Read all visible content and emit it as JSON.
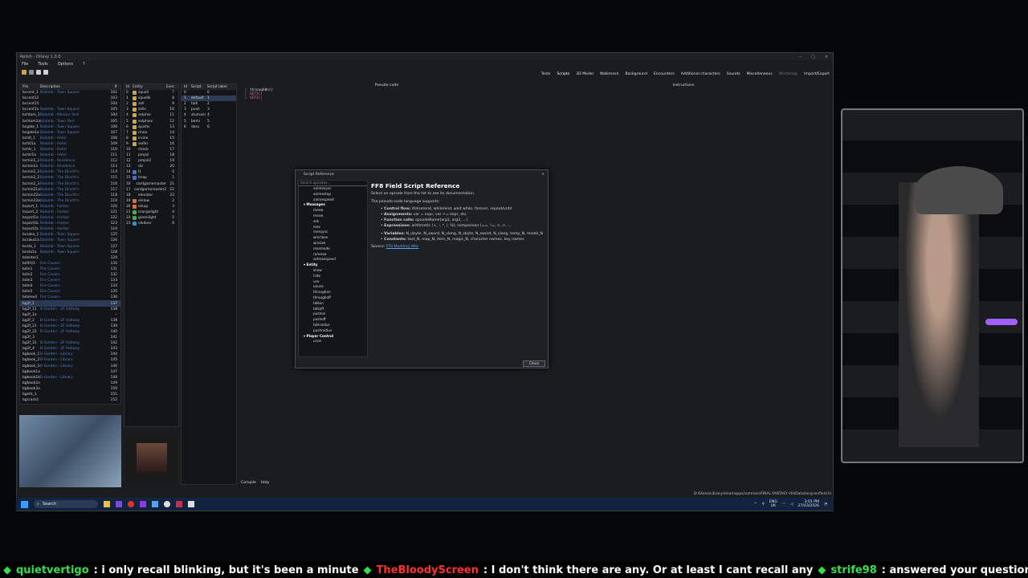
{
  "window": {
    "title": "Relish - Orlevy 1.0.0",
    "menu": [
      "File",
      "Tools",
      "Options",
      "?"
    ],
    "tabs": [
      "Texts",
      "Scripts",
      "3D Model",
      "Walkmesh",
      "Background",
      "Encounters",
      "Additional characters",
      "Sounds",
      "Miscellaneous",
      "Worldmap",
      "Import/Export"
    ],
    "active_tab": "Scripts"
  },
  "file_table": {
    "headers": [
      "File",
      "Description",
      "#"
    ],
    "rows": [
      [
        "bccent_1",
        "Balamb - Town Square",
        "102"
      ],
      [
        "bccent12",
        "",
        "103"
      ],
      [
        "bccent15",
        "",
        "104"
      ],
      [
        "bccent1a",
        "Balamb - Town Square",
        "105"
      ],
      [
        "bchtom_1",
        "Balamb - Mission Yard",
        "104"
      ],
      [
        "bchtom1a",
        "Balamb - Town Yard",
        "105"
      ],
      [
        "bcgate_1",
        "Balamb - Town Square",
        "106"
      ],
      [
        "bcgate1a",
        "Balamb - Town Square",
        "107"
      ],
      [
        "bchtl_1",
        "Balamb - Hotel",
        "108"
      ],
      [
        "bchtl1a",
        "Balamb - Hotel",
        "109"
      ],
      [
        "bchtr_1",
        "Balamb - Hotel",
        "110"
      ],
      [
        "bchtr1a",
        "Balamb - Hotel",
        "111"
      ],
      [
        "bcmin1_1",
        "Balamb - Residence",
        "112"
      ],
      [
        "bcmin1a",
        "Balamb - Residence",
        "113"
      ],
      [
        "bcmin2_1",
        "Balamb - The Dincht's",
        "114"
      ],
      [
        "bcmin2_2",
        "Balamb - The Dincht's",
        "115"
      ],
      [
        "bcmin2_3",
        "Balamb - The Dincht's",
        "116"
      ],
      [
        "bcmin21a",
        "Balamb - The Dincht's",
        "117"
      ],
      [
        "bcmin22a",
        "Balamb - The Dincht's",
        "118"
      ],
      [
        "bcmin23a",
        "Balamb - The Dincht's",
        "119"
      ],
      [
        "bcport_1",
        "Balamb - Harbor",
        "120"
      ],
      [
        "bcport_2",
        "Balamb - Harbor",
        "121"
      ],
      [
        "bcport1a",
        "Balamb - Harbor",
        "122"
      ],
      [
        "bcport1b",
        "Balamb - Harbor",
        "123"
      ],
      [
        "bcport2a",
        "Balamb - Harbor",
        "124"
      ],
      [
        "bcsaka_1",
        "Balamb - Town Square",
        "125"
      ],
      [
        "bcsaka1a",
        "Balamb - Town Square",
        "126"
      ],
      [
        "bcsta_1",
        "Balamb - Town Square",
        "127"
      ],
      [
        "bcsta1a",
        "Balamb - Town Square",
        "128"
      ],
      [
        "bdenter1",
        "",
        "129"
      ],
      [
        "bdifrit1",
        "Fire Cavern",
        "130"
      ],
      [
        "bdin1",
        "Fire Cavern",
        "131"
      ],
      [
        "bdin2",
        "Fire Cavern",
        "132"
      ],
      [
        "bdin3",
        "Fire Cavern",
        "133"
      ],
      [
        "bdin4",
        "Fire Cavern",
        "134"
      ],
      [
        "bdin5",
        "Fire Cavern",
        "135"
      ],
      [
        "bdview1",
        "Fire Cavern",
        "136"
      ],
      [
        "bg2f_1",
        "",
        "137"
      ],
      [
        "bg2f_11",
        "B-Garden - 2F Hallway",
        "138"
      ],
      [
        "bg2f_1a",
        "",
        "--"
      ],
      [
        "bg2f_2",
        "B-Garden - 2F Hallway",
        "138"
      ],
      [
        "bg2f_21",
        "B-Garden - 2F Hallway",
        "139"
      ],
      [
        "bg2f_22",
        "B-Garden - 2F Hallway",
        "140"
      ],
      [
        "bg2f_3",
        "",
        "141"
      ],
      [
        "bg2f_31",
        "B-Garden - 2F Hallway",
        "142"
      ],
      [
        "bg2f_4",
        "B-Garden - 2F Hallway",
        "143"
      ],
      [
        "bgbook_1",
        "B-Garden - Library",
        "144"
      ],
      [
        "bgbook_2",
        "B-Garden - Library",
        "145"
      ],
      [
        "bgbook_3",
        "B-Garden - Library",
        "146"
      ],
      [
        "bgbook1a",
        "",
        "147"
      ],
      [
        "bgbook1b",
        "B-Garden - Library",
        "148"
      ],
      [
        "bgbook2a",
        "",
        "149"
      ],
      [
        "bgbook3a",
        "",
        "150"
      ],
      [
        "bgeht_1",
        "",
        "151"
      ],
      [
        "bgcrash1",
        "",
        "152"
      ]
    ]
  },
  "entity_table": {
    "headers": [
      "Id",
      "Entity",
      "Exec"
    ],
    "rows": [
      [
        "0",
        "squall",
        "7",
        "#c9a64a"
      ],
      [
        "1",
        "squallk",
        "8",
        "#c9a64a"
      ],
      [
        "2",
        "zell",
        "9",
        "#c9a64a"
      ],
      [
        "3",
        "zells",
        "10",
        "#c9a64a"
      ],
      [
        "4",
        "selphie",
        "11",
        "#c9a64a"
      ],
      [
        "5",
        "selphies",
        "12",
        "#c9a64a"
      ],
      [
        "6",
        "quistis",
        "13",
        "#c9a64a"
      ],
      [
        "7",
        "rinoa",
        "14",
        "#c9a64a"
      ],
      [
        "8",
        "irvine",
        "15",
        "#c9a64a"
      ],
      [
        "9",
        "seifer",
        "16",
        "#c9a64a"
      ],
      [
        "10",
        "check",
        "17",
        ""
      ],
      [
        "11",
        "pmpsl",
        "18",
        ""
      ],
      [
        "12",
        "pmpsl2",
        "19",
        ""
      ],
      [
        "13",
        "dic",
        "20",
        ""
      ],
      [
        "14",
        "l1",
        "0",
        "#4a6fd0"
      ],
      [
        "15",
        "lmap",
        "1",
        "#4a6fd0"
      ],
      [
        "16",
        "cardgamemaster",
        "21",
        ""
      ],
      [
        "17",
        "cardgamemaster2",
        "22",
        ""
      ],
      [
        "18",
        "elevator",
        "23",
        ""
      ],
      [
        "19",
        "elelow",
        "2",
        "#e07030"
      ],
      [
        "20",
        "eleup",
        "3",
        "#e07030"
      ],
      [
        "21",
        "orangelight",
        "4",
        "#40b040"
      ],
      [
        "22",
        "greenlight",
        "5",
        "#40b040"
      ],
      [
        "23",
        "eledoor",
        "6",
        "#3090e0"
      ]
    ]
  },
  "script_table": {
    "headers": [
      "Id",
      "Script",
      "Script label"
    ],
    "rows": [
      [
        "0",
        "",
        "0"
      ],
      [
        "1",
        "default",
        "1"
      ],
      [
        "2",
        "talk",
        "2"
      ],
      [
        "3",
        "push",
        "3"
      ],
      [
        "4",
        "stumani",
        "4"
      ],
      [
        "5",
        "bemi",
        "5"
      ],
      [
        "6",
        "deru",
        "6"
      ]
    ]
  },
  "pseudo_code": {
    "header": "Pseudo-code",
    "lines": [
      "through0n()",
      "SET3()",
      "SET3()"
    ]
  },
  "instructions_header": "Instructions",
  "bottom_bar": [
    "Compile",
    "Help"
  ],
  "status_path": "D:/SteamLibrary/steamapps/common/FINAL FANTASY VIII/Data/lang-en/field.fs",
  "dialog": {
    "title": "Script Reference",
    "search_placeholder": "Search opcodes...",
    "ops_top": [
      "animesync",
      "animestop",
      "animespeed"
    ],
    "categories": [
      {
        "name": "Messages",
        "ops": [
          "mesw",
          "mesw",
          "ask",
          "mes",
          "messync",
          "winclose",
          "winsize",
          "mesmode",
          "ramesw",
          "setmesspeed"
        ]
      },
      {
        "name": "Entity",
        "ops": [
          "show",
          "hide",
          "use",
          "unuse",
          "throughon",
          "throughoff",
          "talkon",
          "talkoff",
          "pushon",
          "pushoff",
          "talkradius",
          "pushradius"
        ]
      },
      {
        "name": "Player Control",
        "ops": [
          "ucon"
        ]
      }
    ],
    "heading": "FF8 Field Script Reference",
    "intro": "Select an opcode from the list to see its documentation.",
    "supports": "The pseudo-code language supports:",
    "features": [
      {
        "label": "Control flow:",
        "text": " if/else/end, while/end, wait while, forever, repeat/until"
      },
      {
        "label": "Assignments:",
        "text": " var = expr, var += expr, etc."
      },
      {
        "label": "Function calls:",
        "text": " opcodeName(arg1, arg2, ...)"
      },
      {
        "label": "Expressions:",
        "text": " arithmetic (+, -, *, /, %), comparison (==, !=, <, >, ..."
      }
    ],
    "features2": [
      {
        "label": "Variables:",
        "text": " N_ubyte, N_sword, N_slong, N_sbyte, N_sword, N_slong, temp_N, model_N"
      },
      {
        "label": "Constants:",
        "text": " text_N, map_N, item_N, magic_N, character names, key names"
      }
    ],
    "source_label": "Source:",
    "source_link": "FF8 Modding Wiki",
    "close_label": "Close"
  },
  "taskbar": {
    "search": "Search",
    "lang": "ENG",
    "region": "UK",
    "time": "3:01 PM",
    "date": "27/03/2026"
  },
  "chat": [
    {
      "user": "quietvertigo",
      "color": "#35e04a",
      "msg": ": i only recall blinking, but it's been a minute"
    },
    {
      "user": "TheBloodyScreen",
      "color": "#ff3030",
      "msg": ": I don't think there are any. Or at least I cant recall any"
    },
    {
      "user": "strife98",
      "color": "#35e04a",
      "msg": ": answered your question in dm"
    }
  ]
}
